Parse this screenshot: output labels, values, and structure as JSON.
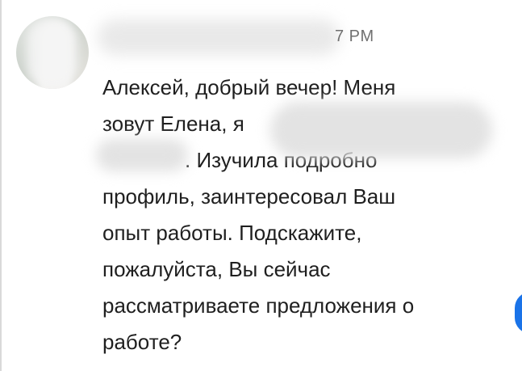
{
  "message": {
    "timestamp": "7 PM",
    "lines": [
      "Алексей, добрый вечер! Меня",
      "зовут Елена, я",
      ". Изучила подробно",
      "профиль, заинтересовал Ваш",
      "опыт работы. Подскажите,",
      "пожалуйста, Вы сейчас",
      "рассматриваете предложения о",
      "работе?"
    ]
  },
  "colors": {
    "text": "#1f1f1f",
    "timestamp": "#707070",
    "accent": "#1a73e8"
  }
}
